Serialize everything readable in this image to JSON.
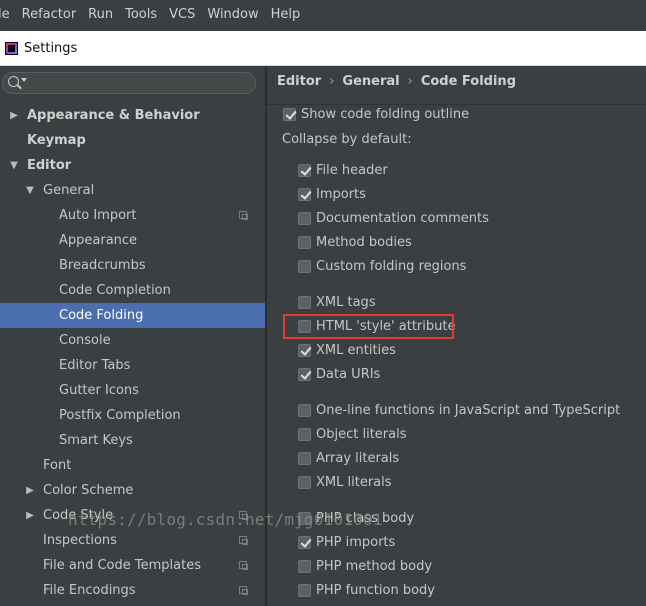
{
  "menu": [
    {
      "label": "le"
    },
    {
      "label": "Refactor"
    },
    {
      "label": "Run"
    },
    {
      "label": "Tools"
    },
    {
      "label": "VCS"
    },
    {
      "label": "Window"
    },
    {
      "label": "Help"
    }
  ],
  "window": {
    "title": "Settings"
  },
  "search": {
    "placeholder": ""
  },
  "tree": [
    {
      "label": "Appearance & Behavior",
      "expanded": false,
      "bold": true
    },
    {
      "label": "Keymap",
      "bold": true
    },
    {
      "label": "Editor",
      "expanded": true,
      "bold": true
    },
    {
      "label": "General",
      "expanded": true
    },
    {
      "label": "Auto Import",
      "project_icon": true
    },
    {
      "label": "Appearance"
    },
    {
      "label": "Breadcrumbs"
    },
    {
      "label": "Code Completion"
    },
    {
      "label": "Code Folding",
      "selected": true
    },
    {
      "label": "Console"
    },
    {
      "label": "Editor Tabs"
    },
    {
      "label": "Gutter Icons"
    },
    {
      "label": "Postfix Completion"
    },
    {
      "label": "Smart Keys"
    },
    {
      "label": "Font"
    },
    {
      "label": "Color Scheme",
      "expanded": false
    },
    {
      "label": "Code Style",
      "expanded": false,
      "project_icon": true
    },
    {
      "label": "Inspections",
      "project_icon": true
    },
    {
      "label": "File and Code Templates",
      "project_icon": true
    },
    {
      "label": "File Encodings",
      "project_icon": true
    }
  ],
  "breadcrumb": [
    "Editor",
    "General",
    "Code Folding"
  ],
  "breadcrumb_separator": "›",
  "show_outline": {
    "label": "Show code folding outline",
    "checked": true
  },
  "collapse_label": "Collapse by default:",
  "options": [
    {
      "label": "File header",
      "checked": true
    },
    {
      "label": "Imports",
      "checked": true
    },
    {
      "label": "Documentation comments",
      "checked": false
    },
    {
      "label": "Method bodies",
      "checked": false
    },
    {
      "label": "Custom folding regions",
      "checked": false
    },
    {
      "label": "XML tags",
      "checked": false
    },
    {
      "label": "HTML 'style' attribute",
      "checked": false,
      "highlighted": true
    },
    {
      "label": "XML entities",
      "checked": true
    },
    {
      "label": "Data URIs",
      "checked": true
    },
    {
      "label": "One-line functions in JavaScript and TypeScript",
      "checked": false
    },
    {
      "label": "Object literals",
      "checked": false
    },
    {
      "label": "Array literals",
      "checked": false
    },
    {
      "label": "XML literals",
      "checked": false
    },
    {
      "label": "PHP class body",
      "checked": false
    },
    {
      "label": "PHP imports",
      "checked": true
    },
    {
      "label": "PHP method body",
      "checked": false
    },
    {
      "label": "PHP function body",
      "checked": false
    }
  ],
  "watermark": "https://blog.csdn.net/mjg0101001",
  "colors": {
    "selection": "#4b6eaf",
    "highlight_border": "#e03a3a",
    "background": "#3c3f41"
  }
}
